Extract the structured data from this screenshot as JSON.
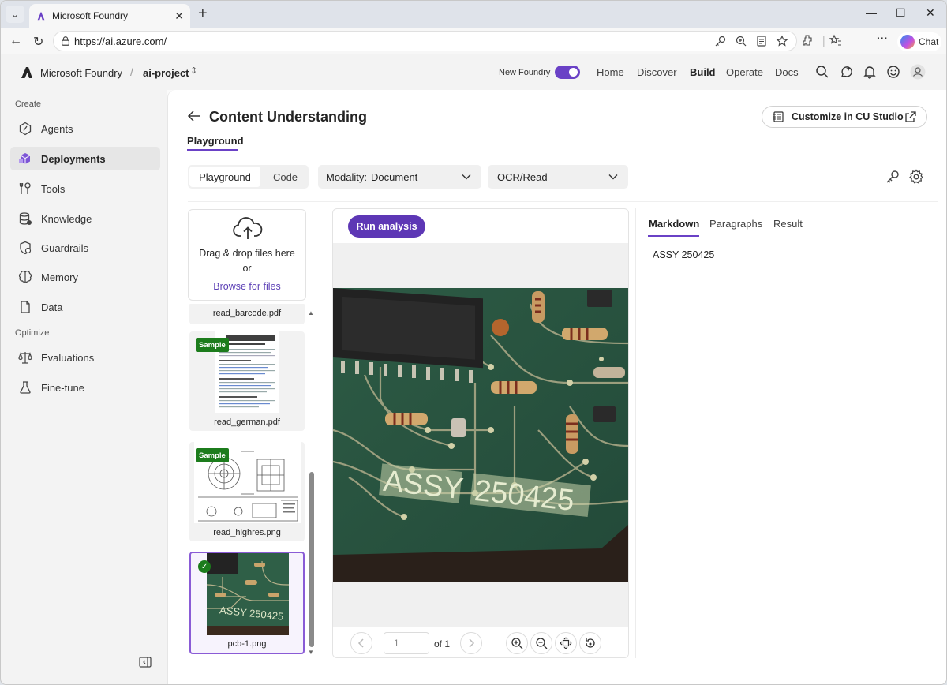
{
  "browser": {
    "tab_title": "Microsoft Foundry",
    "url": "https://ai.azure.com/",
    "chat_label": "Chat",
    "accent": "#6a41c6"
  },
  "header": {
    "brand": "Microsoft Foundry",
    "separator": "/",
    "project": "ai-project",
    "new_foundry_label": "New Foundry",
    "new_foundry_on": true,
    "nav": [
      {
        "label": "Home",
        "active": false
      },
      {
        "label": "Discover",
        "active": false
      },
      {
        "label": "Build",
        "active": true
      },
      {
        "label": "Operate",
        "active": false
      },
      {
        "label": "Docs",
        "active": false
      }
    ],
    "icons": [
      "search-icon",
      "copilot-icon",
      "bell-icon",
      "smiley-icon",
      "user-icon"
    ]
  },
  "sidebar": {
    "sections": [
      {
        "label": "Create",
        "items": [
          {
            "label": "Agents",
            "icon": "agents-icon"
          },
          {
            "label": "Deployments",
            "icon": "cube-icon",
            "active": true
          },
          {
            "label": "Tools",
            "icon": "wrench-icon"
          },
          {
            "label": "Knowledge",
            "icon": "database-icon"
          },
          {
            "label": "Guardrails",
            "icon": "shield-icon"
          },
          {
            "label": "Memory",
            "icon": "brain-icon"
          },
          {
            "label": "Data",
            "icon": "document-icon"
          }
        ]
      },
      {
        "label": "Optimize",
        "items": [
          {
            "label": "Evaluations",
            "icon": "scale-icon"
          },
          {
            "label": "Fine-tune",
            "icon": "flask-icon"
          }
        ]
      }
    ]
  },
  "page": {
    "title": "Content Understanding",
    "customize_label": "Customize in CU Studio",
    "subtab": "Playground",
    "segments": [
      "Playground",
      "Code"
    ],
    "active_segment": "Playground",
    "modality_label": "Modality:",
    "modality_value": "Document",
    "analyzer_value": "OCR/Read"
  },
  "files": {
    "drop_text": "Drag & drop files here",
    "or_text": "or",
    "browse_label": "Browse for files",
    "items": [
      {
        "name": "read_barcode.pdf",
        "badge": ""
      },
      {
        "name": "read_german.pdf",
        "badge": "Sample"
      },
      {
        "name": "read_highres.png",
        "badge": "Sample"
      },
      {
        "name": "pcb-1.png",
        "badge": "",
        "selected": true
      }
    ],
    "german_doc_heading": "IRS-Unterstützung in Katastrophenfällen"
  },
  "preview": {
    "run_label": "Run analysis",
    "page_value": "1",
    "page_of": "of 1",
    "image_text": [
      "ASSY",
      "250425"
    ]
  },
  "results": {
    "tabs": [
      "Markdown",
      "Paragraphs",
      "Result"
    ],
    "active_tab": "Markdown",
    "content": "ASSY 250425"
  }
}
